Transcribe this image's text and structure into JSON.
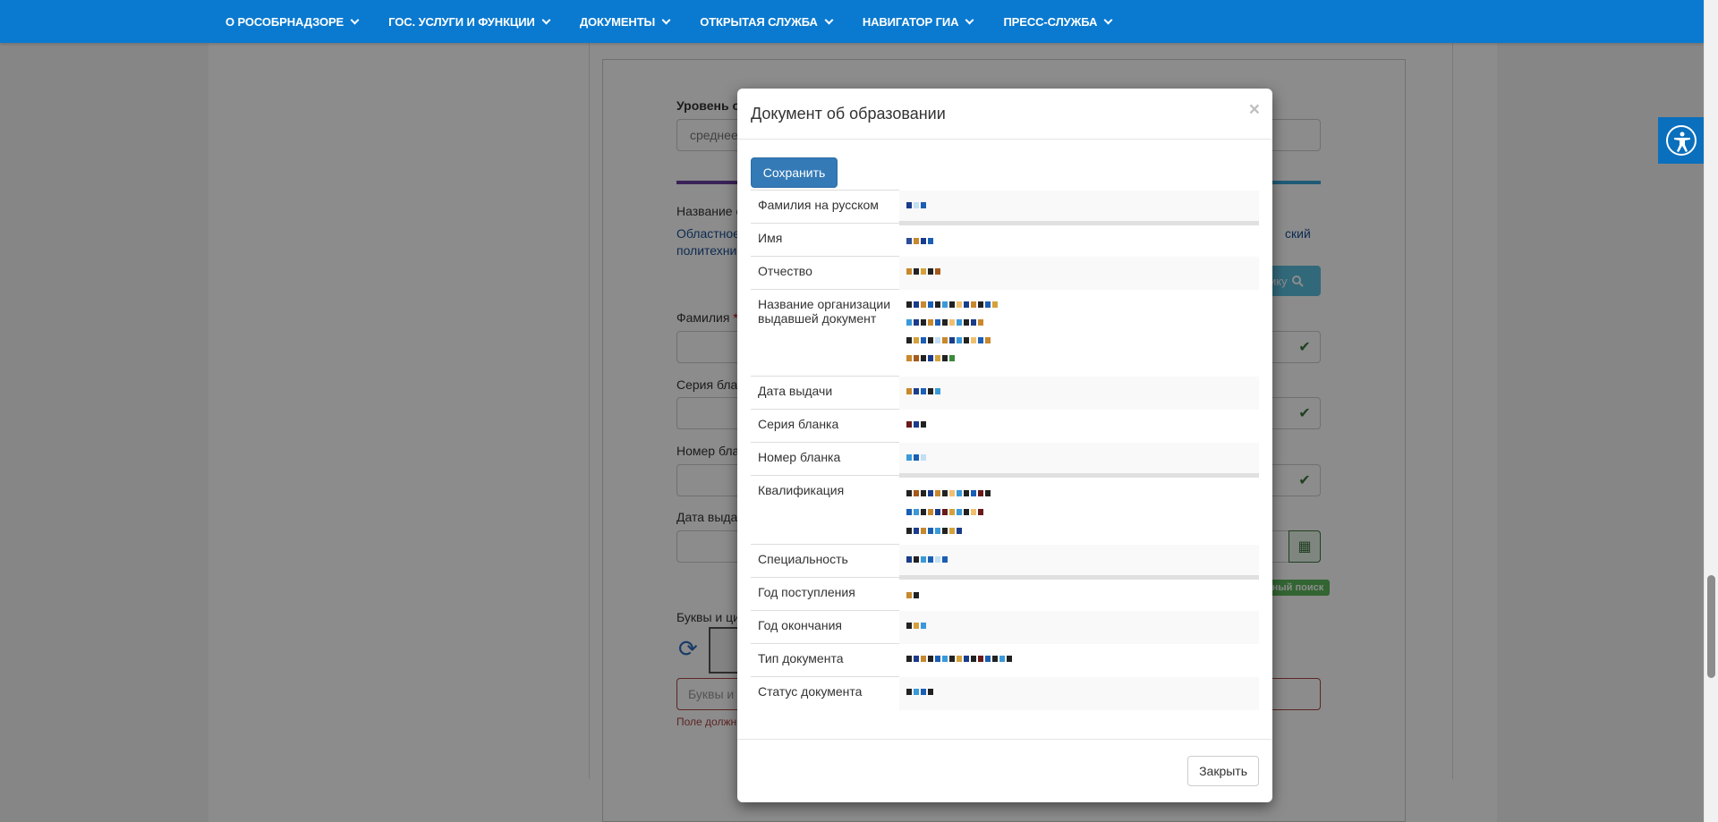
{
  "nav": {
    "items": [
      {
        "label": "О РОСОБРНАДЗОРЕ"
      },
      {
        "label": "ГОС. УСЛУГИ И ФУНКЦИИ"
      },
      {
        "label": "ДОКУМЕНТЫ"
      },
      {
        "label": "ОТКРЫТАЯ СЛУЖБА"
      },
      {
        "label": "НАВИГАТОР ГИА"
      },
      {
        "label": "ПРЕСС-СЛУЖБА"
      }
    ]
  },
  "background_form": {
    "level_label": "Уровень о",
    "level_value": "среднее",
    "org_label": "Название о",
    "org_link_line1": "Областное",
    "org_link_line1_right": "ский",
    "org_link_line2": "политехни",
    "search_button": "ику",
    "surname_label": "Фамилия",
    "series_label": "Серия бла",
    "number_label": "Номер бла",
    "date_label": "Дата выда",
    "advanced_search": "нный поиск",
    "captcha_label": "Буквы и ци",
    "captcha_placeholder": "Буквы и",
    "captcha_error": "Поле должн"
  },
  "modal": {
    "title": "Документ об образовании",
    "close_symbol": "×",
    "save_label": "Сохранить",
    "close_label": "Закрыть",
    "rows": [
      {
        "label": "Фамилия на русском"
      },
      {
        "label": "Имя"
      },
      {
        "label": "Отчество"
      },
      {
        "label": "Название организации выдавшей документ"
      },
      {
        "label": "Дата выдачи"
      },
      {
        "label": "Серия бланка"
      },
      {
        "label": "Номер бланка"
      },
      {
        "label": "Квалификация"
      },
      {
        "label": "Специальность"
      },
      {
        "label": "Год поступления"
      },
      {
        "label": "Год окончания"
      },
      {
        "label": "Тип документа"
      },
      {
        "label": "Статус документа"
      }
    ]
  },
  "colors": {
    "nav_bg": "#0a7ad0",
    "primary_button": "#337ab7",
    "accessibility_button": "#0a6fbd"
  }
}
